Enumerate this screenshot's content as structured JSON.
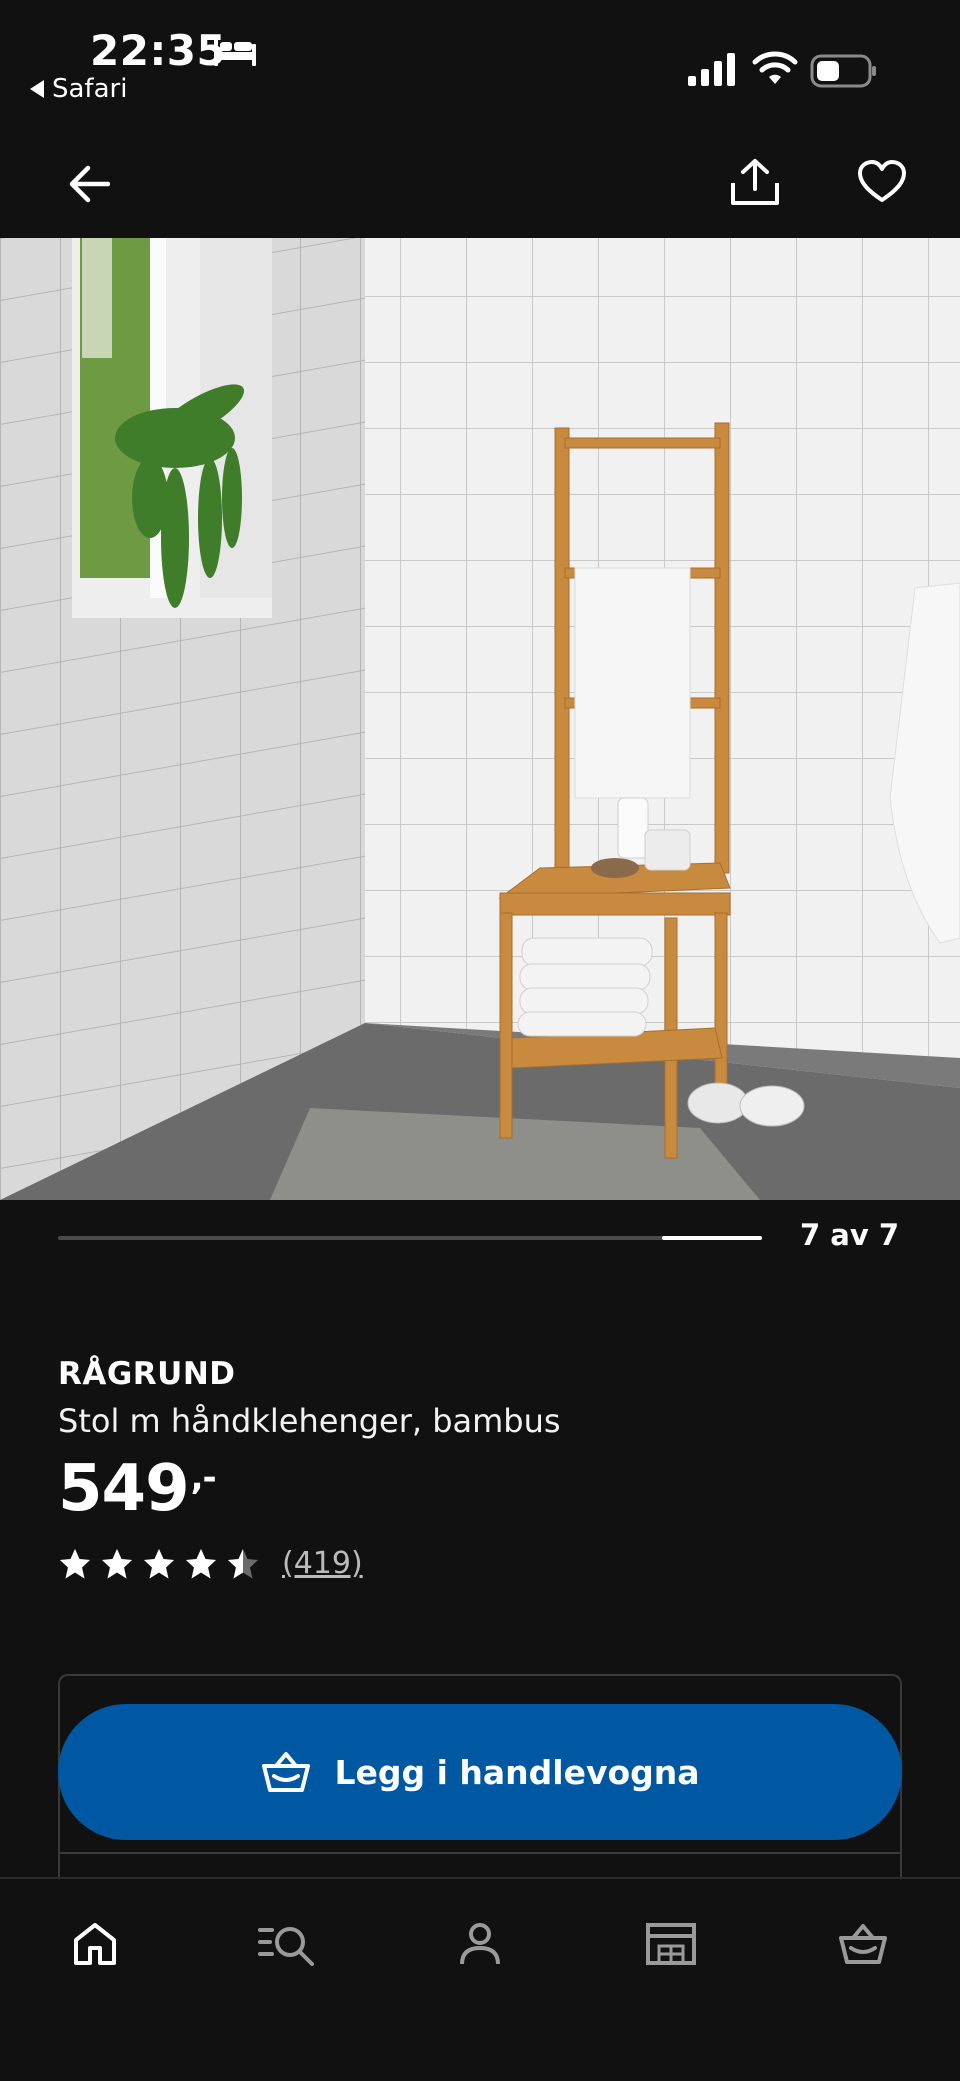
{
  "status_bar": {
    "time": "22:35",
    "back_app": "Safari",
    "icons": [
      "bed-icon",
      "signal-icon",
      "wifi-icon",
      "battery-icon"
    ]
  },
  "nav": {
    "icons": [
      "back-arrow-icon",
      "share-icon",
      "heart-icon"
    ]
  },
  "product_image": {
    "subject": "bamboo-chair-with-towel-rack"
  },
  "carousel": {
    "counter": "7 av 7",
    "position_fraction": 1.0
  },
  "product": {
    "name": "RÅGRUND",
    "description": "Stol m håndklehenger, bambus",
    "price": "549",
    "price_suffix": ",-",
    "rating": 4.5,
    "rating_max": 5,
    "review_count": "(419)"
  },
  "actions": {
    "add_to_cart_label": "Legg i handlevogna"
  },
  "tab_bar": {
    "items": [
      "home-icon",
      "search-icon",
      "account-icon",
      "store-icon",
      "cart-icon"
    ]
  },
  "colors": {
    "background": "#111111",
    "accent_blue": "#0058a3",
    "text": "#ffffff",
    "muted": "#bbbbbb"
  }
}
